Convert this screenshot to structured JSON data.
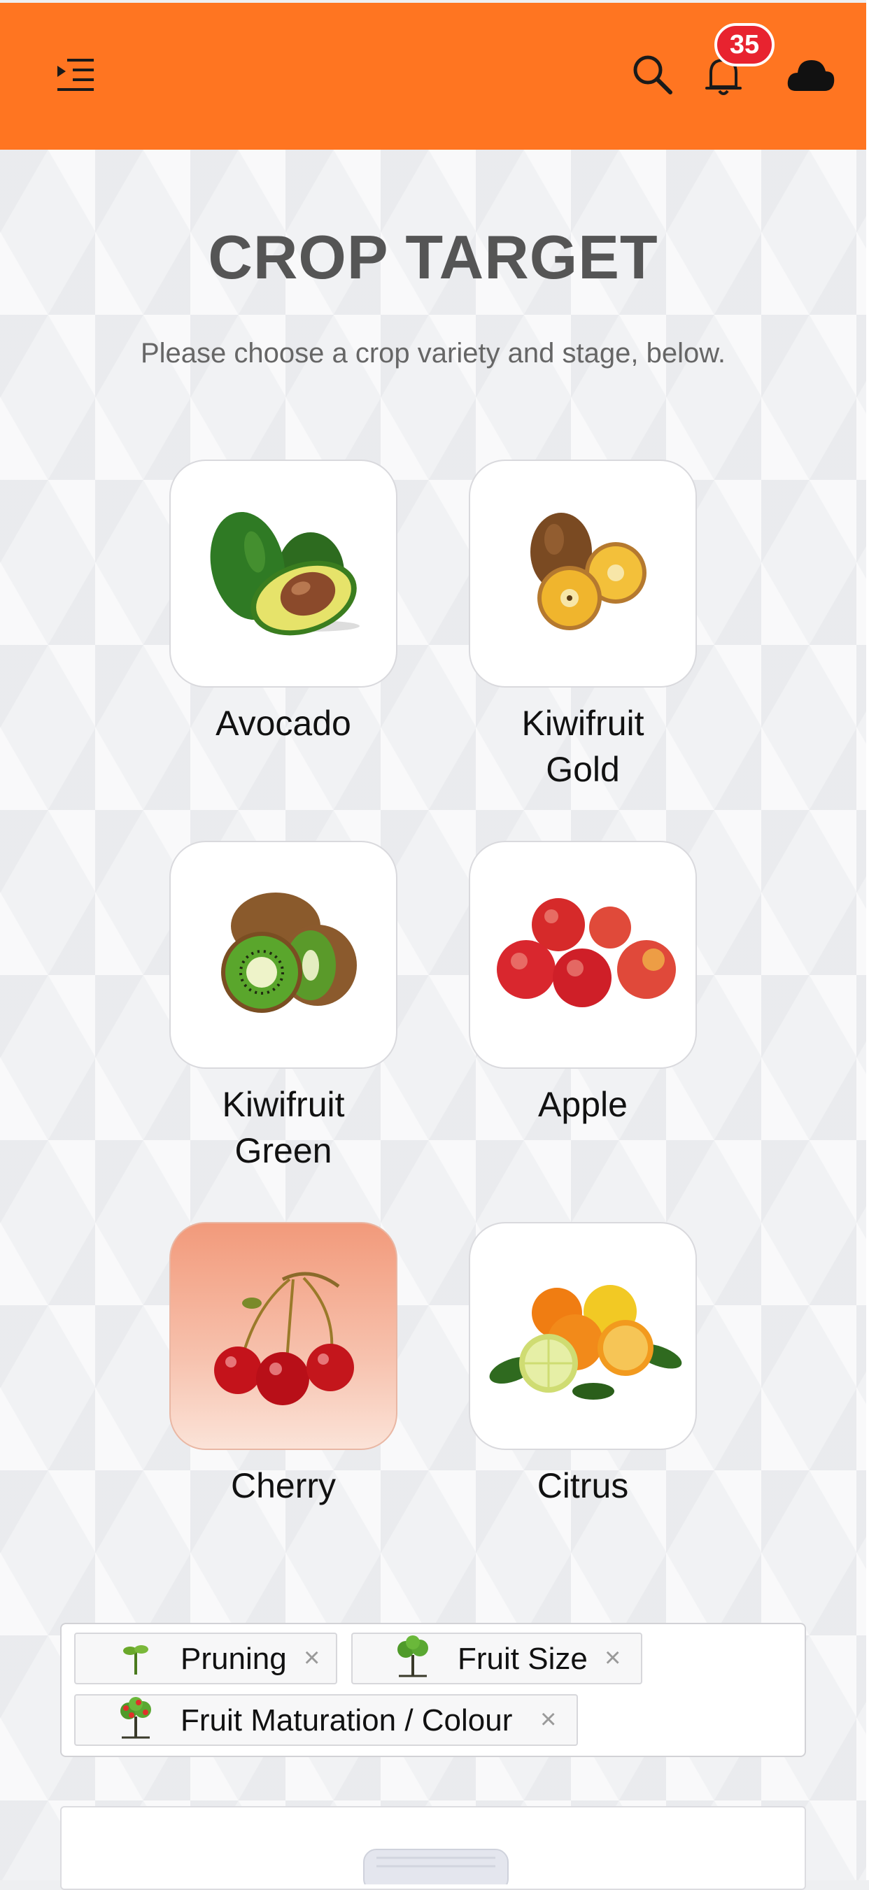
{
  "header": {
    "menu_icon": "menu-indent-icon",
    "search_icon": "search-icon",
    "bell_icon": "bell-icon",
    "notification_count": "35",
    "cloud_icon": "cloud-icon",
    "bar_color": "#ff7521",
    "badge_color": "#e8232f"
  },
  "page": {
    "title": "CROP TARGET",
    "subtitle": "Please choose a crop variety and stage, below."
  },
  "crops": [
    {
      "label": "Avocado",
      "icon": "avocado-image",
      "selected": false
    },
    {
      "label": "Kiwifruit\nGold",
      "icon": "kiwifruit-gold-image",
      "selected": false
    },
    {
      "label": "Kiwifruit\nGreen",
      "icon": "kiwifruit-green-image",
      "selected": false
    },
    {
      "label": "Apple",
      "icon": "apple-image",
      "selected": false
    },
    {
      "label": "Cherry",
      "icon": "cherry-image",
      "selected": true
    },
    {
      "label": "Citrus",
      "icon": "citrus-image",
      "selected": false
    }
  ],
  "stages": [
    {
      "label": "Pruning",
      "icon": "seedling-icon",
      "close": "×"
    },
    {
      "label": "Fruit Size",
      "icon": "tree-icon",
      "close": "×"
    },
    {
      "label": "Fruit Maturation / Colour",
      "icon": "fruit-tree-icon",
      "close": "×"
    }
  ]
}
